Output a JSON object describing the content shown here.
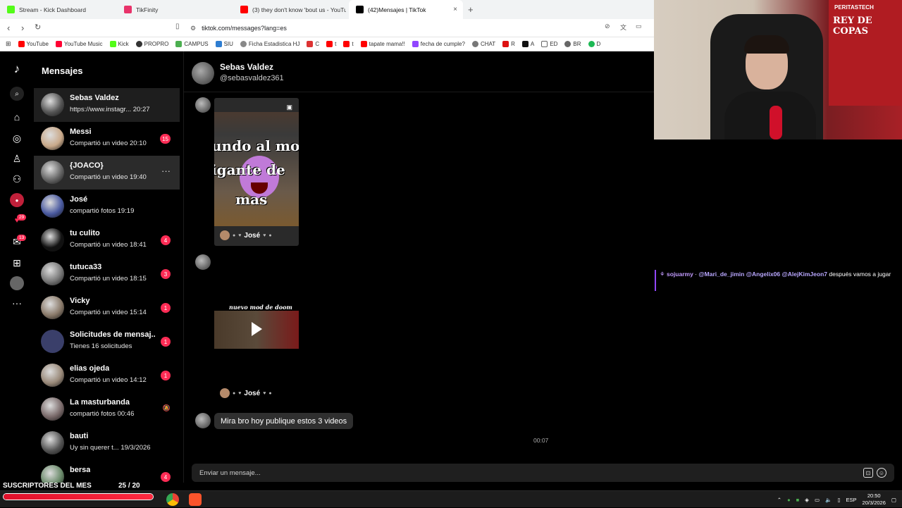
{
  "browser": {
    "tabs": [
      {
        "label": "Stream - Kick Dashboard",
        "color": "#53fc18"
      },
      {
        "label": "TikFinity",
        "color": "#e8336a"
      },
      {
        "label": "(3) they don't know 'bout us - YouTube",
        "color": "#ff0000"
      },
      {
        "label": "(42)Mensajes | TikTok",
        "color": "#000000"
      }
    ],
    "new_tab": "+",
    "close_tab": "×",
    "url": "tiktok.com/messages?lang=es",
    "bookmarks": [
      "YouTube",
      "YouTube Music",
      "Kick",
      "PROPRO",
      "CAMPUS",
      "SIU",
      "Ficha Estadistica HJ",
      "C",
      "t",
      "t",
      "tapate mama!!",
      "fecha de cumple?",
      "CHAT",
      "R",
      "A",
      "ED",
      "BR",
      "D"
    ]
  },
  "rail": {
    "badges": {
      "friends": "29",
      "inbox": "13"
    }
  },
  "messages": {
    "title": "Mensajes",
    "conversations": [
      {
        "name": "Sebas Valdez",
        "preview": "https://www.instagr... 20:27",
        "badge": "",
        "color": "#555"
      },
      {
        "name": "Messi",
        "preview": "Compartió un video 20:10",
        "badge": "15",
        "color": "#c9a98a"
      },
      {
        "name": "{JOACO}",
        "preview": "Compartió un video 19:40",
        "badge": "",
        "color": "#666"
      },
      {
        "name": "José",
        "preview": "compartió fotos 19:19",
        "badge": "",
        "color": "#4a5aa0"
      },
      {
        "name": "tu culito",
        "preview": "Compartió un video 18:41",
        "badge": "4",
        "color": "#111"
      },
      {
        "name": "tutuca33",
        "preview": "Compartió un video 18:15",
        "badge": "3",
        "color": "#777"
      },
      {
        "name": "Vicky",
        "preview": "Compartió un video 15:14",
        "badge": "1",
        "color": "#8a7a6a"
      },
      {
        "name": "Solicitudes de mensaj...",
        "preview": "Tienes 16 solicitudes",
        "badge": "1",
        "color": "#3a3f6a"
      },
      {
        "name": "elias ojeda",
        "preview": "Compartió un video 14:12",
        "badge": "1",
        "color": "#9a8a7a"
      },
      {
        "name": "La masturbanda",
        "preview": "compartió fotos 00:46",
        "badge": "",
        "color": "#7a6a6a"
      },
      {
        "name": "bauti",
        "preview": "Uy sin querer t...   19/3/2026",
        "badge": "",
        "color": "#555"
      },
      {
        "name": "bersa",
        "preview": "",
        "badge": "4",
        "color": "#6a8a6a"
      }
    ]
  },
  "chat": {
    "name": "Sebas Valdez",
    "username": "@sebasvaldez361",
    "card1": {
      "text_top": "undo al mo",
      "text_mid": "igante de",
      "text_bot": "mas",
      "author": "José"
    },
    "card2": {
      "caption": "nuevo mod de doom",
      "author": "José"
    },
    "bubble": "Mira bro hoy publique estos 3 videos",
    "time": "00:07",
    "composer_placeholder": "Enviar un mensaje..."
  },
  "webcam": {
    "flag_top": "PERITASTECH",
    "flag_mid": "REY DE COPAS"
  },
  "stream_chat": {
    "user": "sojuarmy",
    "mentions": "@Mari_de_jimin @Angelix06 @AlejKimJeon7",
    "text": "después vamos a jugar"
  },
  "subs": {
    "label": "SUSCRIPTORES DEL MES",
    "count": "25  / 20",
    "progress": 1.0
  },
  "taskbar": {
    "lang": "ESP",
    "time": "20:50",
    "date": "20/3/2026"
  }
}
